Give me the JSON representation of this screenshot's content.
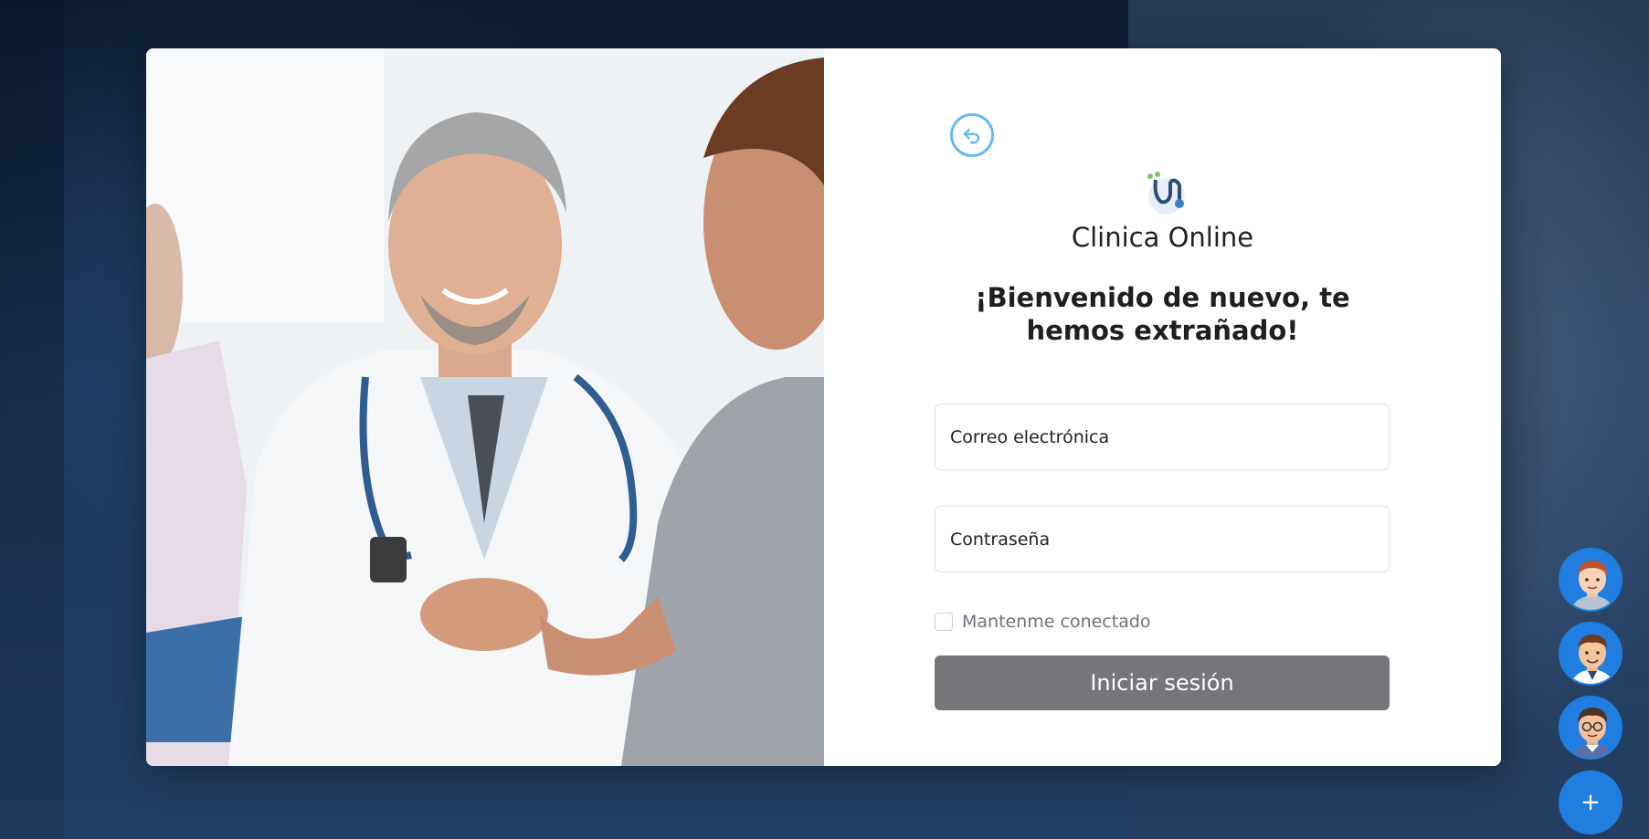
{
  "brand": {
    "name": "Clinica Online"
  },
  "welcome": {
    "title": "¡Bienvenido de nuevo, te hemos extrañado!"
  },
  "form": {
    "email_placeholder": "Correo electrónica",
    "password_placeholder": "Contraseña",
    "remember_label": "Mantenme conectado",
    "remember_checked": false,
    "submit_label": "Iniciar sesión"
  },
  "quick_users": [
    {
      "icon": "avatar-user-1"
    },
    {
      "icon": "avatar-user-2"
    },
    {
      "icon": "avatar-user-3"
    }
  ],
  "fab": {
    "label": "+"
  },
  "colors": {
    "accent": "#1f7ee0",
    "back_button_ring": "#6ab8f2",
    "submit_bg": "#75767a",
    "page_bg": "#1c3555"
  }
}
